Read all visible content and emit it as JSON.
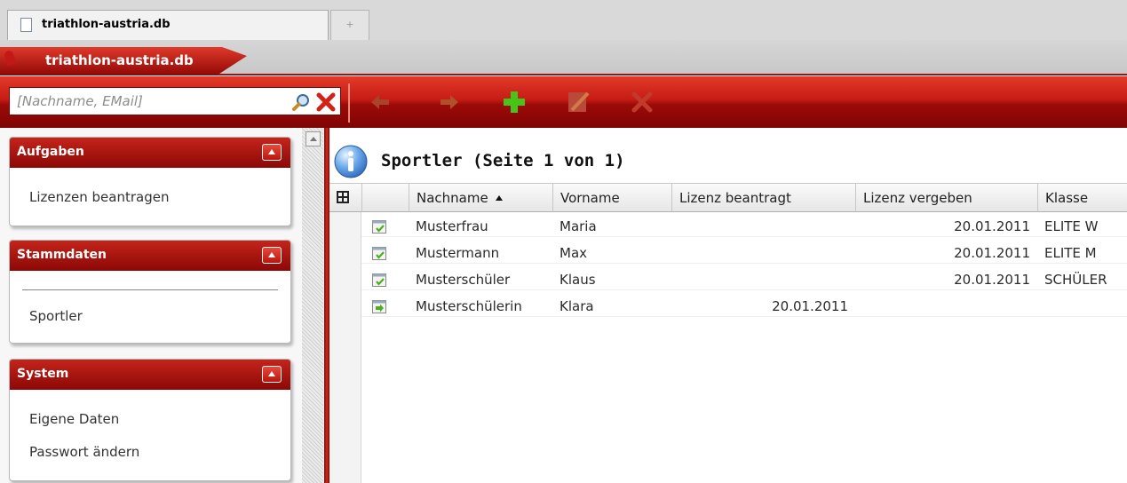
{
  "browser": {
    "tab_title": "triathlon-austria.db",
    "new_tab_symbol": "+"
  },
  "app": {
    "title": "triathlon-austria.db"
  },
  "toolbar": {
    "search_placeholder": "[Nachname, EMail]",
    "buttons": [
      "back-icon",
      "forward-icon",
      "add-icon",
      "edit-icon",
      "delete-icon"
    ]
  },
  "sidebar": {
    "panels": [
      {
        "title": "Aufgaben",
        "items": [
          "Lizenzen beantragen"
        ]
      },
      {
        "title": "Stammdaten",
        "items": [
          "Sportler"
        ]
      },
      {
        "title": "System",
        "items": [
          "Eigene Daten",
          "Passwort ändern"
        ]
      }
    ]
  },
  "main": {
    "title": "Sportler (Seite 1 von 1)",
    "columns": [
      "Nachname",
      "Vorname",
      "Lizenz beantragt",
      "Lizenz vergeben",
      "Klasse"
    ],
    "sorted_column": "Nachname",
    "rows": [
      {
        "nachname": "Musterfrau",
        "vorname": "Maria",
        "beantragt": "",
        "vergeben": "20.01.2011",
        "klasse": "ELITE W",
        "icon": "edit-record-icon"
      },
      {
        "nachname": "Mustermann",
        "vorname": "Max",
        "beantragt": "",
        "vergeben": "20.01.2011",
        "klasse": "ELITE M",
        "icon": "edit-record-icon"
      },
      {
        "nachname": "Musterschüler",
        "vorname": "Klaus",
        "beantragt": "",
        "vergeben": "20.01.2011",
        "klasse": "SCHÜLER",
        "icon": "edit-record-icon"
      },
      {
        "nachname": "Musterschülerin",
        "vorname": "Klara",
        "beantragt": "20.01.2011",
        "vergeben": "",
        "klasse": "",
        "icon": "forward-record-icon"
      }
    ]
  },
  "colors": {
    "brand_red": "#c41c14",
    "dark_red": "#8c0806",
    "add_green": "#44c014"
  }
}
